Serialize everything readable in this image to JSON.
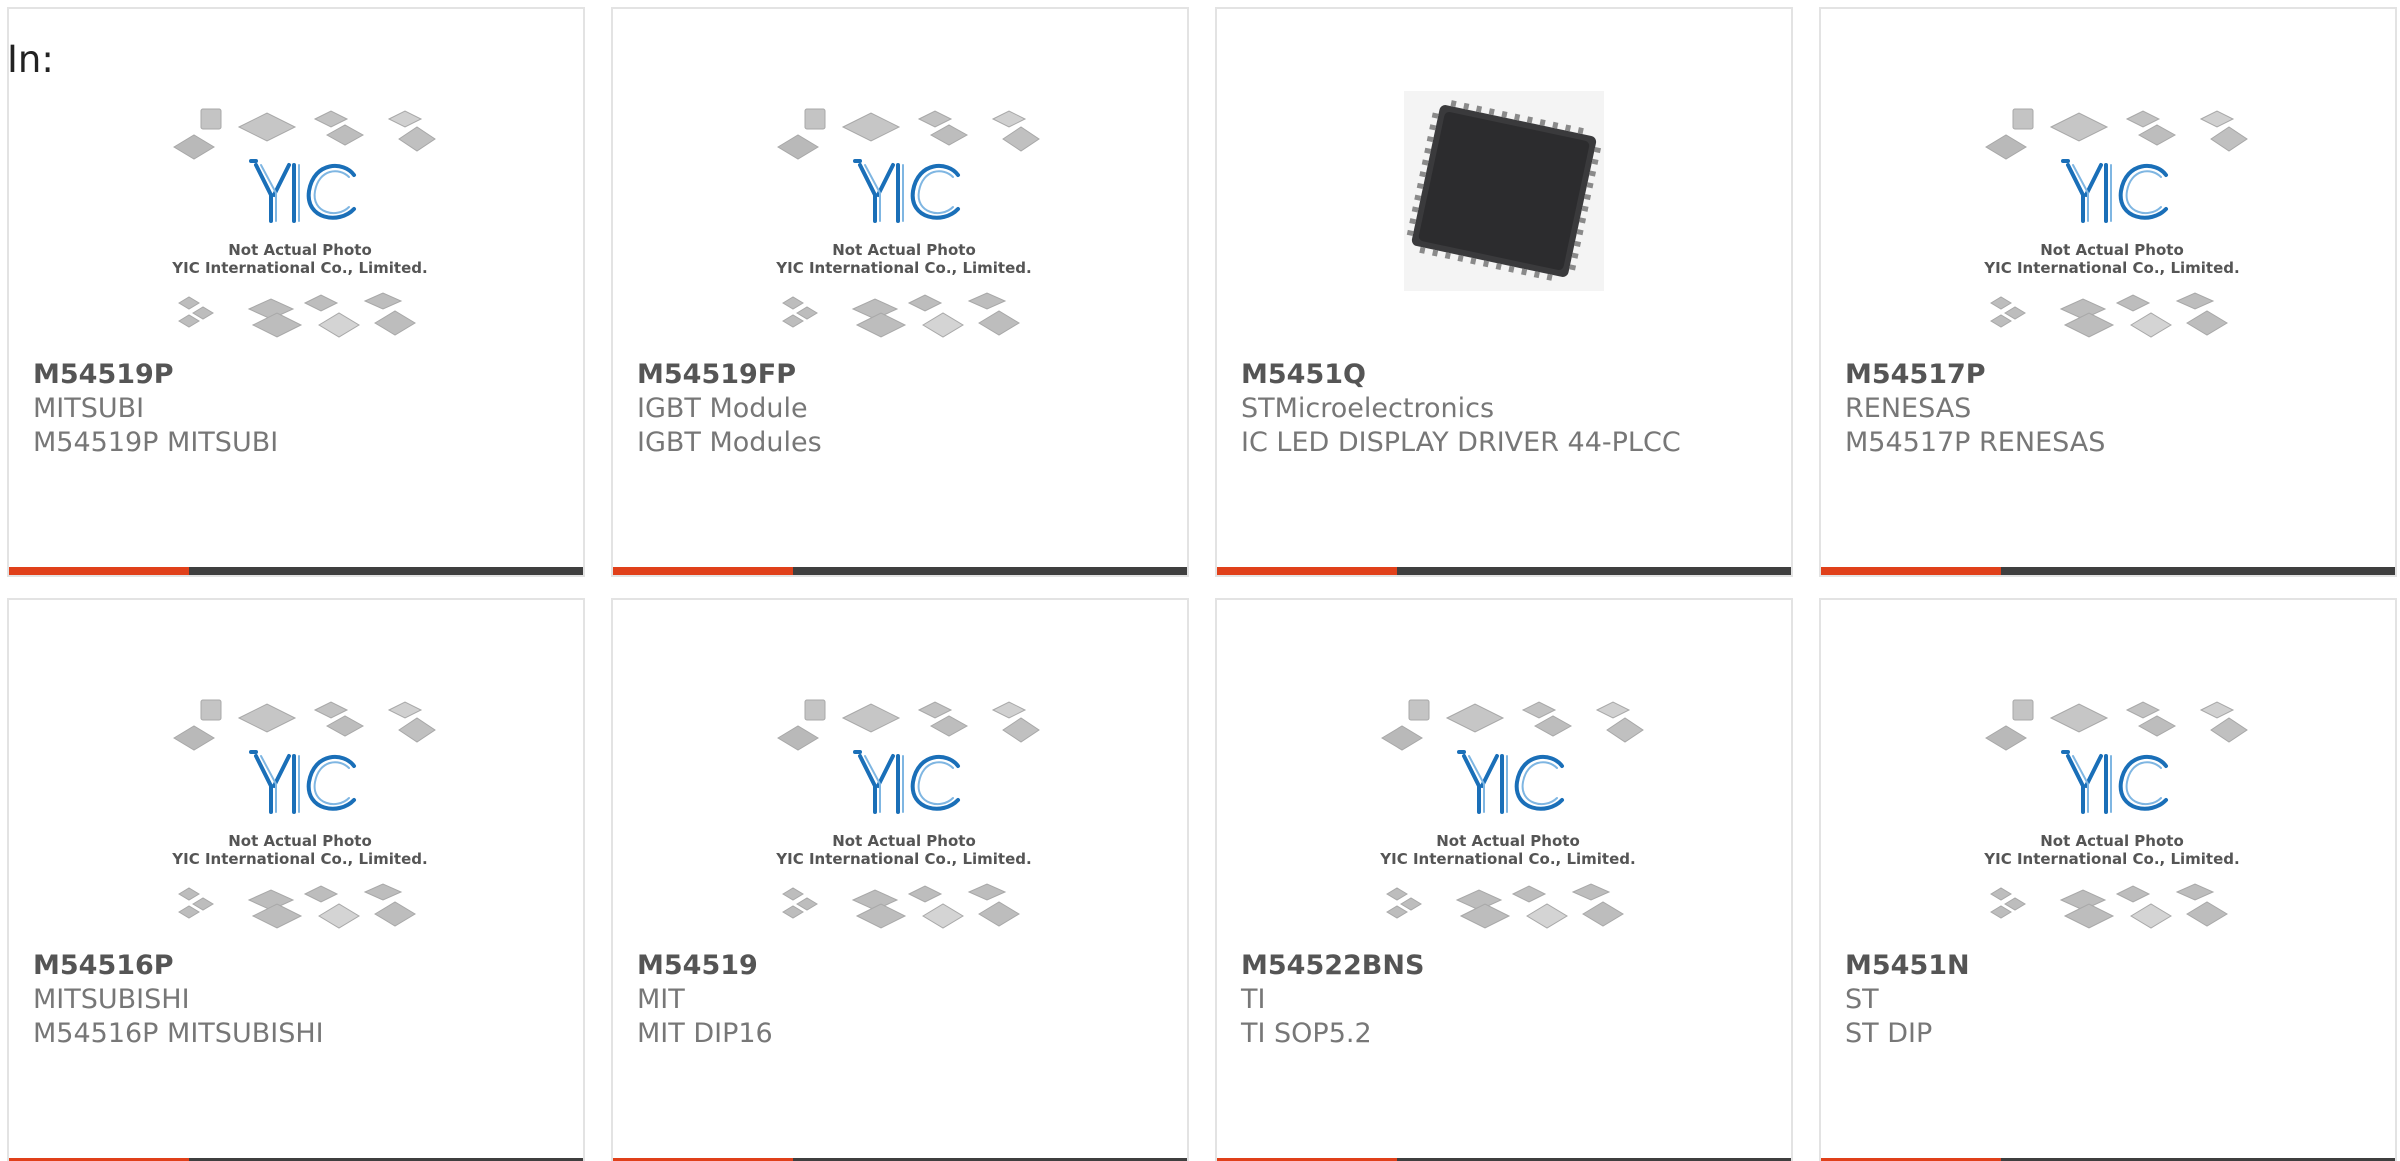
{
  "header": {
    "in_label": "In:"
  },
  "placeholder_text": {
    "line1": "Not Actual Photo",
    "line2": "YIC International Co., Limited.",
    "logo": "YIC"
  },
  "colors": {
    "accent_bar": "#e0401a",
    "dark_bar": "#3f3f3f",
    "logo_blue": "#1a6fb8"
  },
  "products": [
    {
      "part": "M54519P",
      "brand": "MITSUBI",
      "desc": "M54519P MITSUBI",
      "image": "placeholder"
    },
    {
      "part": "M54519FP",
      "brand": "IGBT Module",
      "desc": "IGBT Modules",
      "image": "placeholder"
    },
    {
      "part": "M5451Q",
      "brand": "STMicroelectronics",
      "desc": "IC LED DISPLAY DRIVER 44-PLCC",
      "image": "plcc-chip"
    },
    {
      "part": "M54517P",
      "brand": "RENESAS",
      "desc": "M54517P RENESAS",
      "image": "placeholder"
    },
    {
      "part": "M54516P",
      "brand": "MITSUBISHI",
      "desc": "M54516P MITSUBISHI",
      "image": "placeholder"
    },
    {
      "part": "M54519",
      "brand": "MIT",
      "desc": "MIT DIP16",
      "image": "placeholder"
    },
    {
      "part": "M54522BNS",
      "brand": "TI",
      "desc": "TI SOP5.2",
      "image": "placeholder"
    },
    {
      "part": "M5451N",
      "brand": "ST",
      "desc": "ST DIP",
      "image": "placeholder"
    }
  ]
}
